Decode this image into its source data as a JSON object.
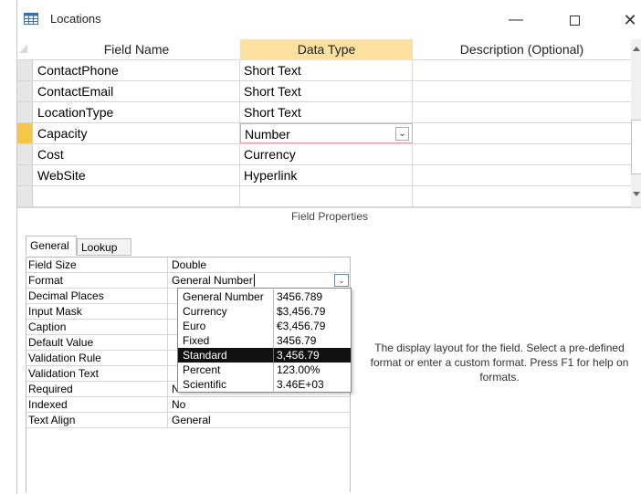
{
  "window": {
    "title": "Locations"
  },
  "grid": {
    "headers": {
      "field_name": "Field Name",
      "data_type": "Data Type",
      "description": "Description (Optional)"
    },
    "rows": [
      {
        "field": "ContactPhone",
        "type": "Short Text"
      },
      {
        "field": "ContactEmail",
        "type": "Short Text"
      },
      {
        "field": "LocationType",
        "type": "Short Text"
      },
      {
        "field": "Capacity",
        "type": "Number"
      },
      {
        "field": "Cost",
        "type": "Currency"
      },
      {
        "field": "WebSite",
        "type": "Hyperlink"
      },
      {
        "field": "",
        "type": ""
      }
    ]
  },
  "field_properties_label": "Field Properties",
  "tabs": {
    "general": "General",
    "lookup": "Lookup"
  },
  "properties": [
    {
      "label": "Field Size",
      "value": "Double"
    },
    {
      "label": "Format",
      "value": "General Number"
    },
    {
      "label": "Decimal Places",
      "value": ""
    },
    {
      "label": "Input Mask",
      "value": ""
    },
    {
      "label": "Caption",
      "value": ""
    },
    {
      "label": "Default Value",
      "value": ""
    },
    {
      "label": "Validation Rule",
      "value": ""
    },
    {
      "label": "Validation Text",
      "value": ""
    },
    {
      "label": "Required",
      "value": "No"
    },
    {
      "label": "Indexed",
      "value": "No"
    },
    {
      "label": "Text Align",
      "value": "General"
    }
  ],
  "format_options": [
    {
      "name": "General Number",
      "example": "3456.789"
    },
    {
      "name": "Currency",
      "example": "$3,456.79"
    },
    {
      "name": "Euro",
      "example": "€3,456.79"
    },
    {
      "name": "Fixed",
      "example": "3456.79"
    },
    {
      "name": "Standard",
      "example": "3,456.79"
    },
    {
      "name": "Percent",
      "example": "123.00%"
    },
    {
      "name": "Scientific",
      "example": "3.46E+03"
    }
  ],
  "help_text": "The display layout for the field. Select a pre-defined format or enter a custom format. Press F1 for help on formats.",
  "colors": {
    "active_row": "#f7c548",
    "header_highlight": "#fbe0a0",
    "selected_option": "#111111"
  }
}
